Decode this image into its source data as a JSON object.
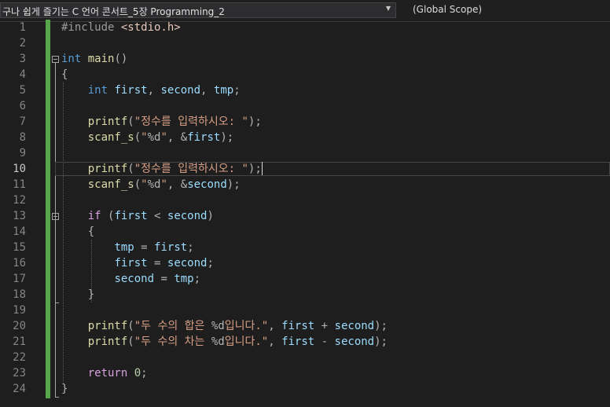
{
  "toolbar": {
    "project_dropdown": "구나 쉽게 즐기는 C 언어 콘서트_5장 Programming_2",
    "scope_dropdown": "(Global Scope)"
  },
  "editor": {
    "active_line": 10,
    "lines": [
      {
        "n": "1",
        "tokens": [
          {
            "t": "#include ",
            "c": "pp"
          },
          {
            "t": "<stdio.h>",
            "c": "inc"
          }
        ]
      },
      {
        "n": "2",
        "tokens": []
      },
      {
        "n": "3",
        "tokens": [
          {
            "t": "int",
            "c": "kw"
          },
          {
            "t": " ",
            "c": ""
          },
          {
            "t": "main",
            "c": "fn"
          },
          {
            "t": "()",
            "c": "punc"
          }
        ]
      },
      {
        "n": "4",
        "tokens": [
          {
            "t": "{",
            "c": "punc"
          }
        ]
      },
      {
        "n": "5",
        "tokens": [
          {
            "t": "    ",
            "c": ""
          },
          {
            "t": "int",
            "c": "kw"
          },
          {
            "t": " ",
            "c": ""
          },
          {
            "t": "first",
            "c": "var"
          },
          {
            "t": ", ",
            "c": "punc"
          },
          {
            "t": "second",
            "c": "var"
          },
          {
            "t": ", ",
            "c": "punc"
          },
          {
            "t": "tmp",
            "c": "var"
          },
          {
            "t": ";",
            "c": "punc"
          }
        ]
      },
      {
        "n": "6",
        "tokens": []
      },
      {
        "n": "7",
        "tokens": [
          {
            "t": "    ",
            "c": ""
          },
          {
            "t": "printf",
            "c": "fn"
          },
          {
            "t": "(",
            "c": "punc"
          },
          {
            "t": "\"정수를 입력하시오: \"",
            "c": "str"
          },
          {
            "t": ");",
            "c": "punc"
          }
        ]
      },
      {
        "n": "8",
        "tokens": [
          {
            "t": "    ",
            "c": ""
          },
          {
            "t": "scanf_s",
            "c": "fn"
          },
          {
            "t": "(",
            "c": "punc"
          },
          {
            "t": "\"",
            "c": "str"
          },
          {
            "t": "%d",
            "c": "fmt"
          },
          {
            "t": "\"",
            "c": "str"
          },
          {
            "t": ", &",
            "c": "punc"
          },
          {
            "t": "first",
            "c": "var"
          },
          {
            "t": ");",
            "c": "punc"
          }
        ]
      },
      {
        "n": "9",
        "tokens": []
      },
      {
        "n": "10",
        "tokens": [
          {
            "t": "    ",
            "c": ""
          },
          {
            "t": "printf",
            "c": "fn"
          },
          {
            "t": "(",
            "c": "punc"
          },
          {
            "t": "\"정수를 입력하시오: \"",
            "c": "str"
          },
          {
            "t": ");",
            "c": "punc"
          }
        ]
      },
      {
        "n": "11",
        "tokens": [
          {
            "t": "    ",
            "c": ""
          },
          {
            "t": "scanf_s",
            "c": "fn"
          },
          {
            "t": "(",
            "c": "punc"
          },
          {
            "t": "\"",
            "c": "str"
          },
          {
            "t": "%d",
            "c": "fmt"
          },
          {
            "t": "\"",
            "c": "str"
          },
          {
            "t": ", &",
            "c": "punc"
          },
          {
            "t": "second",
            "c": "var"
          },
          {
            "t": ");",
            "c": "punc"
          }
        ]
      },
      {
        "n": "12",
        "tokens": []
      },
      {
        "n": "13",
        "tokens": [
          {
            "t": "    ",
            "c": ""
          },
          {
            "t": "if",
            "c": "kw2"
          },
          {
            "t": " (",
            "c": "punc"
          },
          {
            "t": "first",
            "c": "var"
          },
          {
            "t": " < ",
            "c": "punc"
          },
          {
            "t": "second",
            "c": "var"
          },
          {
            "t": ")",
            "c": "punc"
          }
        ]
      },
      {
        "n": "14",
        "tokens": [
          {
            "t": "    ",
            "c": ""
          },
          {
            "t": "{",
            "c": "punc"
          }
        ]
      },
      {
        "n": "15",
        "tokens": [
          {
            "t": "        ",
            "c": ""
          },
          {
            "t": "tmp",
            "c": "var"
          },
          {
            "t": " = ",
            "c": "punc"
          },
          {
            "t": "first",
            "c": "var"
          },
          {
            "t": ";",
            "c": "punc"
          }
        ]
      },
      {
        "n": "16",
        "tokens": [
          {
            "t": "        ",
            "c": ""
          },
          {
            "t": "first",
            "c": "var"
          },
          {
            "t": " = ",
            "c": "punc"
          },
          {
            "t": "second",
            "c": "var"
          },
          {
            "t": ";",
            "c": "punc"
          }
        ]
      },
      {
        "n": "17",
        "tokens": [
          {
            "t": "        ",
            "c": ""
          },
          {
            "t": "second",
            "c": "var"
          },
          {
            "t": " = ",
            "c": "punc"
          },
          {
            "t": "tmp",
            "c": "var"
          },
          {
            "t": ";",
            "c": "punc"
          }
        ]
      },
      {
        "n": "18",
        "tokens": [
          {
            "t": "    ",
            "c": ""
          },
          {
            "t": "}",
            "c": "punc"
          }
        ]
      },
      {
        "n": "19",
        "tokens": []
      },
      {
        "n": "20",
        "tokens": [
          {
            "t": "    ",
            "c": ""
          },
          {
            "t": "printf",
            "c": "fn"
          },
          {
            "t": "(",
            "c": "punc"
          },
          {
            "t": "\"두 수의 합은 ",
            "c": "str"
          },
          {
            "t": "%d",
            "c": "fmt"
          },
          {
            "t": "입니다.\"",
            "c": "str"
          },
          {
            "t": ", ",
            "c": "punc"
          },
          {
            "t": "first",
            "c": "var"
          },
          {
            "t": " + ",
            "c": "punc"
          },
          {
            "t": "second",
            "c": "var"
          },
          {
            "t": ");",
            "c": "punc"
          }
        ]
      },
      {
        "n": "21",
        "tokens": [
          {
            "t": "    ",
            "c": ""
          },
          {
            "t": "printf",
            "c": "fn"
          },
          {
            "t": "(",
            "c": "punc"
          },
          {
            "t": "\"두 수의 차는 ",
            "c": "str"
          },
          {
            "t": "%d",
            "c": "fmt"
          },
          {
            "t": "입니다.\"",
            "c": "str"
          },
          {
            "t": ", ",
            "c": "punc"
          },
          {
            "t": "first",
            "c": "var"
          },
          {
            "t": " - ",
            "c": "punc"
          },
          {
            "t": "second",
            "c": "var"
          },
          {
            "t": ");",
            "c": "punc"
          }
        ]
      },
      {
        "n": "22",
        "tokens": []
      },
      {
        "n": "23",
        "tokens": [
          {
            "t": "    ",
            "c": ""
          },
          {
            "t": "return",
            "c": "kw2"
          },
          {
            "t": " ",
            "c": ""
          },
          {
            "t": "0",
            "c": "num-lit"
          },
          {
            "t": ";",
            "c": "punc"
          }
        ]
      },
      {
        "n": "24",
        "tokens": [
          {
            "t": "}",
            "c": "punc"
          }
        ]
      }
    ]
  }
}
